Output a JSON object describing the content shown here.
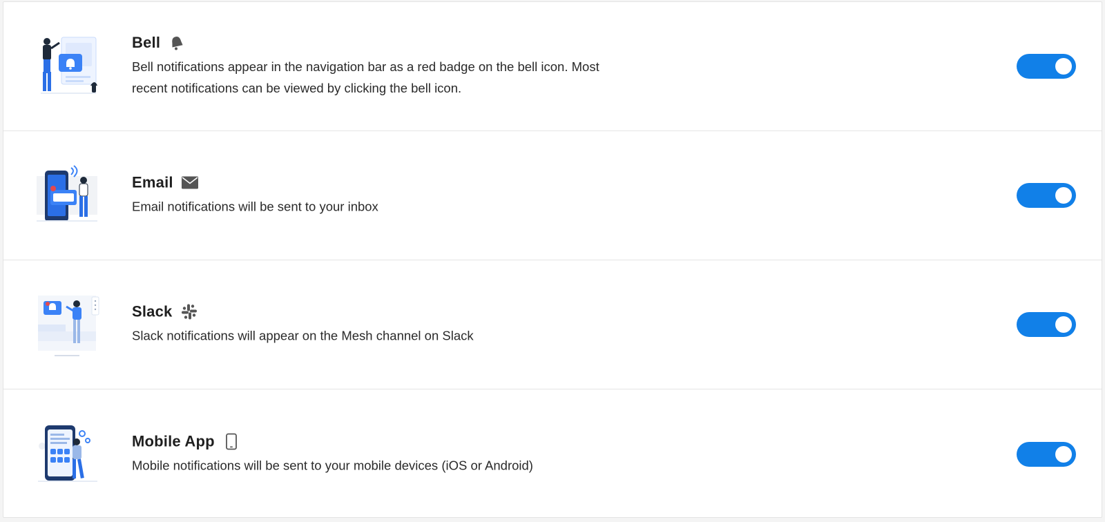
{
  "settings": [
    {
      "id": "bell",
      "title": "Bell",
      "icon": "bell-icon",
      "description": "Bell notifications appear in the navigation bar as a red badge on the bell icon. Most recent notifications can be viewed by clicking the bell icon.",
      "enabled": true
    },
    {
      "id": "email",
      "title": "Email",
      "icon": "envelope-icon",
      "description": "Email notifications will be sent to your inbox",
      "enabled": true
    },
    {
      "id": "slack",
      "title": "Slack",
      "icon": "slack-icon",
      "description": "Slack notifications will appear on the Mesh channel on Slack",
      "enabled": true
    },
    {
      "id": "mobile",
      "title": "Mobile App",
      "icon": "mobile-phone-icon",
      "description": "Mobile notifications will be sent to your mobile devices (iOS or Android)",
      "enabled": true
    }
  ],
  "colors": {
    "toggle_on": "#1180e8",
    "illustration_blue": "#3b82f6",
    "icon_gray": "#555555"
  }
}
